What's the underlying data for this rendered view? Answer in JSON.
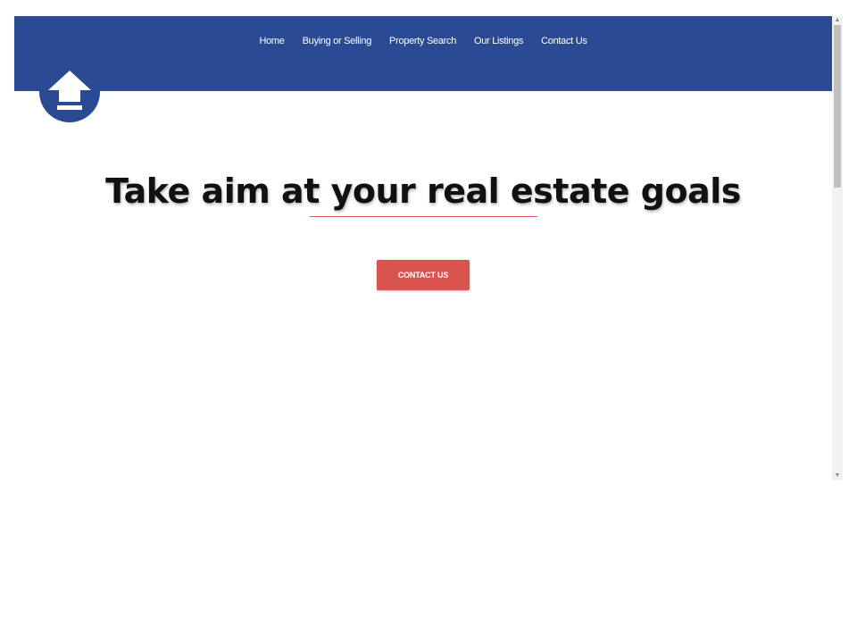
{
  "nav": {
    "items": [
      "Home",
      "Buying or Selling",
      "Property Search",
      "Our Listings",
      "Contact Us"
    ]
  },
  "logo": {
    "icon": "house-arrow-icon"
  },
  "hero": {
    "headline": "Take aim at your real estate goals",
    "cta_label": "CONTACT US"
  },
  "colors": {
    "header": "#2b4a94",
    "accent": "#d9534f",
    "underline": "#e05c5c"
  }
}
